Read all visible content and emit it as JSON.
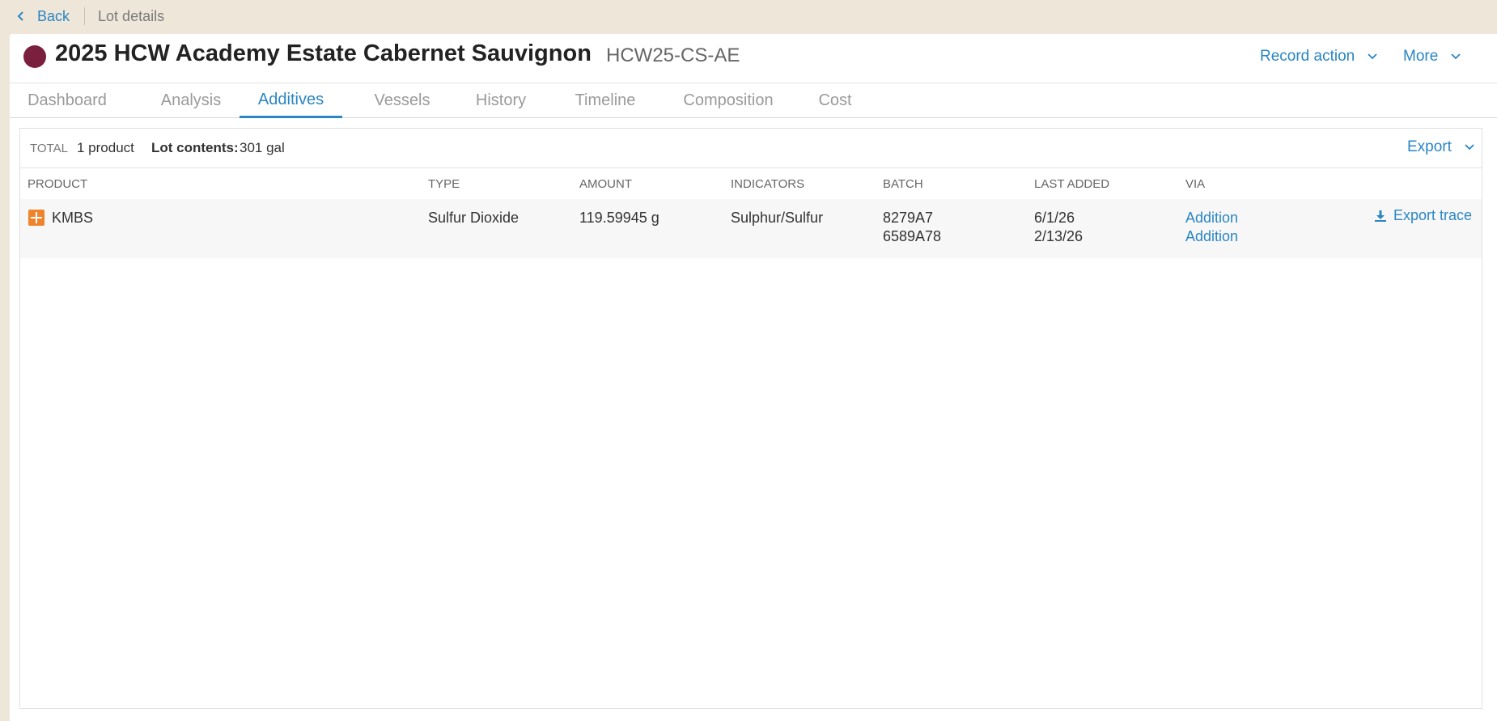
{
  "breadcrumb": {
    "back_label": "Back",
    "current": "Lot details"
  },
  "lot": {
    "title": "2025 HCW Academy Estate Cabernet Sauvignon",
    "code": "HCW25-CS-AE",
    "color": "#7a1f3d"
  },
  "header_actions": {
    "record_action": "Record action",
    "more": "More"
  },
  "tabs": [
    {
      "label": "Dashboard"
    },
    {
      "label": "Analysis"
    },
    {
      "label": "Additives",
      "active": true
    },
    {
      "label": "Vessels"
    },
    {
      "label": "History"
    },
    {
      "label": "Timeline"
    },
    {
      "label": "Composition"
    },
    {
      "label": "Cost"
    }
  ],
  "summary": {
    "total_label": "TOTAL",
    "count": "1 product",
    "lot_contents_label": "Lot contents:",
    "lot_contents_value": "301 gal",
    "export_label": "Export"
  },
  "table": {
    "columns": [
      "PRODUCT",
      "TYPE",
      "AMOUNT",
      "INDICATORS",
      "BATCH",
      "LAST ADDED",
      "VIA"
    ],
    "rows": [
      {
        "product": "KMBS",
        "product_icon": "plus-square-icon",
        "type": "Sulfur Dioxide",
        "amount": "119.59945 g",
        "indicators": "Sulphur/Sulfur",
        "batches": [
          "8279A7",
          "6589A78"
        ],
        "last_added": [
          "6/1/26",
          "2/13/26"
        ],
        "via": [
          "Addition",
          "Addition"
        ],
        "export_trace_label": "Export trace"
      }
    ]
  },
  "colors": {
    "accent": "#2a86c4",
    "page_bg": "#efe6da",
    "product_icon": "#f0842c"
  }
}
